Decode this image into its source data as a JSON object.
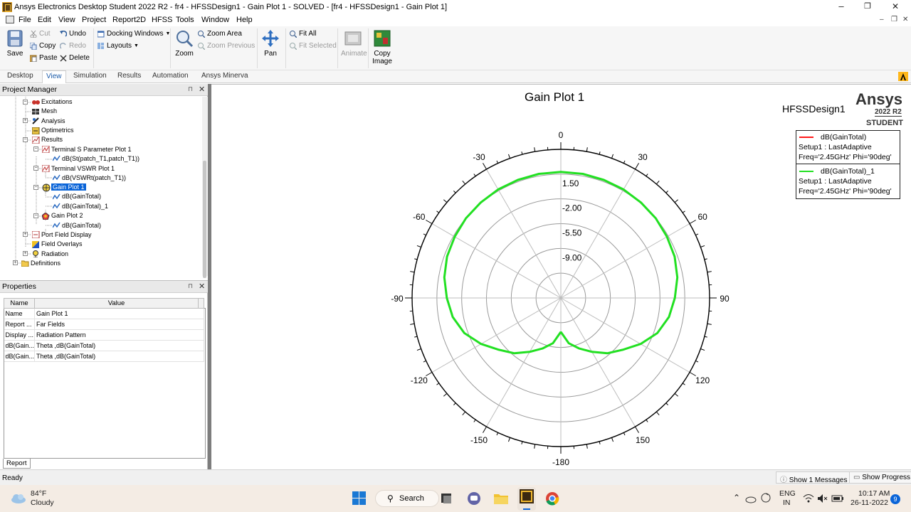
{
  "window": {
    "title": "Ansys Electronics Desktop Student 2022 R2 - fr4 - HFSSDesign1 - Gain Plot 1 - SOLVED - [fr4 - HFSSDesign1 - Gain Plot 1]",
    "minimize": "–",
    "maximize": "❐",
    "close": "✕"
  },
  "menu": {
    "items": [
      "File",
      "Edit",
      "View",
      "Project",
      "Report2D",
      "HFSS",
      "Tools",
      "Window",
      "Help"
    ],
    "mdi_minimize": "–",
    "mdi_restore": "❐",
    "mdi_close": "✕"
  },
  "ribbon": {
    "save": "Save",
    "cut": "Cut",
    "copy": "Copy",
    "paste": "Paste",
    "undo": "Undo",
    "redo": "Redo",
    "delete": "Delete",
    "docking_windows": "Docking Windows",
    "layouts": "Layouts",
    "zoom": "Zoom",
    "zoom_area": "Zoom Area",
    "zoom_previous": "Zoom Previous",
    "pan": "Pan",
    "fit_all": "Fit All",
    "fit_selected": "Fit Selected",
    "animate": "Animate",
    "copy_image_line1": "Copy",
    "copy_image_line2": "Image",
    "tabs": [
      "Desktop",
      "View",
      "Simulation",
      "Results",
      "Automation",
      "Ansys Minerva"
    ],
    "active_tab": "View"
  },
  "project_manager": {
    "title": "Project Manager",
    "pin": "⊓",
    "close": "✕",
    "tree": [
      {
        "label": "Excitations",
        "icon": "excitations-icon"
      },
      {
        "label": "Mesh",
        "icon": "mesh-icon"
      },
      {
        "label": "Analysis",
        "icon": "analysis-icon"
      },
      {
        "label": "Optimetrics",
        "icon": "optimetrics-icon"
      },
      {
        "label": "Results",
        "icon": "results-icon"
      },
      {
        "label": "Terminal S Parameter Plot 1",
        "icon": "rect-plot-icon"
      },
      {
        "label": "dB(St(patch_T1,patch_T1))",
        "icon": "trace-icon"
      },
      {
        "label": "Terminal VSWR Plot 1",
        "icon": "rect-plot-icon"
      },
      {
        "label": "dB(VSWRt(patch_T1))",
        "icon": "trace-icon"
      },
      {
        "label": "Gain Plot 1",
        "icon": "radiation-plot-icon"
      },
      {
        "label": "dB(GainTotal)",
        "icon": "trace-icon"
      },
      {
        "label": "dB(GainTotal)_1",
        "icon": "trace-icon"
      },
      {
        "label": "Gain Plot 2",
        "icon": "3d-plot-icon"
      },
      {
        "label": "dB(GainTotal)",
        "icon": "trace-icon"
      },
      {
        "label": "Port Field Display",
        "icon": "port-field-icon"
      },
      {
        "label": "Field Overlays",
        "icon": "field-overlays-icon"
      },
      {
        "label": "Radiation",
        "icon": "radiation-icon"
      },
      {
        "label": "Definitions",
        "icon": "folder-icon"
      }
    ]
  },
  "properties": {
    "title": "Properties",
    "pin": "⊓",
    "close": "✕",
    "col_name": "Name",
    "col_value": "Value",
    "rows": [
      {
        "name": "Name",
        "value": "Gain Plot 1"
      },
      {
        "name": "Report ...",
        "value": "Far Fields"
      },
      {
        "name": "Display ...",
        "value": "Radiation Pattern"
      },
      {
        "name": "dB(Gain...",
        "value": "Theta ,dB(GainTotal)"
      },
      {
        "name": "dB(Gain...",
        "value": "Theta ,dB(GainTotal)"
      }
    ],
    "tab": "Report"
  },
  "plot": {
    "title": "Gain Plot 1",
    "design": "HFSSDesign1",
    "brand": "Ansys",
    "version": "2022 R2",
    "edition": "STUDENT",
    "legend": [
      {
        "name": "dB(GainTotal)",
        "setup": "Setup1 : LastAdaptive",
        "freq": "Freq='2.45GHz' Phi='90deg'",
        "color": "#ff1a1a"
      },
      {
        "name": "dB(GainTotal)_1",
        "setup": "Setup1 : LastAdaptive",
        "freq": "Freq='2.45GHz' Phi='90deg'",
        "color": "#22e022"
      }
    ]
  },
  "chart_data": {
    "type": "polar-line",
    "title": "Gain Plot 1",
    "angle_unit": "deg",
    "angle_ticks": [
      0,
      30,
      60,
      90,
      120,
      150,
      -180,
      -150,
      -120,
      -90,
      -60,
      -30
    ],
    "radial_ticks": [
      1.5,
      -2.0,
      -5.5,
      -9.0
    ],
    "radial_tick_labels": [
      "1.50",
      "-2.00",
      "-5.50",
      "-9.00"
    ],
    "radial_range": [
      -16.0,
      5.0
    ],
    "grid": true,
    "legend_position": "top-right",
    "series": [
      {
        "name": "dB(GainTotal)_1",
        "color": "#22e022",
        "theta": [
          -180,
          -170,
          -160,
          -150,
          -140,
          -130,
          -120,
          -110,
          -100,
          -90,
          -80,
          -70,
          -60,
          -50,
          -40,
          -30,
          -20,
          -10,
          0,
          10,
          20,
          30,
          40,
          50,
          60,
          70,
          80,
          90,
          100,
          110,
          120,
          130,
          140,
          150,
          160,
          170,
          180
        ],
        "gain_db": [
          -11.2,
          -9.5,
          -8.4,
          -7.2,
          -5.8,
          -4.6,
          -3.0,
          -1.5,
          -0.5,
          0.1,
          0.7,
          1.1,
          1.3,
          1.5,
          1.6,
          1.7,
          1.75,
          1.8,
          1.8,
          1.8,
          1.75,
          1.7,
          1.6,
          1.5,
          1.3,
          1.1,
          0.7,
          0.1,
          -0.5,
          -1.5,
          -3.0,
          -4.6,
          -5.8,
          -7.2,
          -8.4,
          -9.5,
          -11.2
        ]
      }
    ]
  },
  "statusbar": {
    "status": "Ready",
    "messages": "Show 1 Messages",
    "progress": "Show Progress"
  },
  "taskbar": {
    "temp": "84°F",
    "weather": "Cloudy",
    "search": "Search",
    "lang1": "ENG",
    "lang2": "IN",
    "time": "10:17 AM",
    "date": "26-11-2022",
    "notif_count": "9"
  }
}
